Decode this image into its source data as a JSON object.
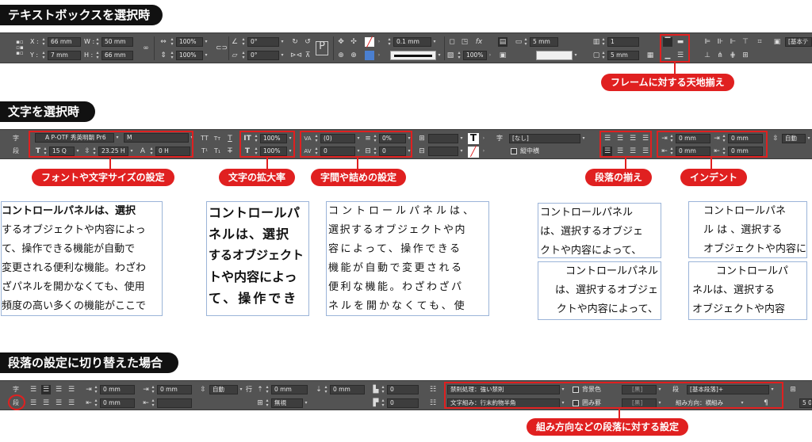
{
  "sections": {
    "textbox": "テキストボックスを選択時",
    "character": "文字を選択時",
    "paragraph": "段落の設定に切り替えた場合"
  },
  "toolbar1": {
    "x_label": "X :",
    "x_value": "66 mm",
    "y_label": "Y :",
    "y_value": "7 mm",
    "w_label": "W :",
    "w_value": "50 mm",
    "h_label": "H :",
    "h_value": "66 mm",
    "scale_x": "100%",
    "scale_y": "100%",
    "angle": "0°",
    "shear": "0°",
    "stroke_weight": "0.1 mm",
    "opacity": "100%",
    "col_gutter": "5 mm",
    "inset": "5 mm",
    "columns": "1",
    "style": "[基本テ"
  },
  "toolbar2": {
    "char_label": "字",
    "para_label": "段",
    "font_family": "A P-OTF 秀英明朝 Pr6",
    "font_style": "M",
    "font_size": "15 Q",
    "leading": "23.25 H",
    "tracking_h": "0 H",
    "scale_v": "100%",
    "scale_h": "100%",
    "kerning": "(0)",
    "tsume": "0%",
    "tracking": "0",
    "aki": "0",
    "char_style_label": "字",
    "char_style": "[なし]",
    "tate_chu_yoko": "縦中横",
    "indent_left": "0 mm",
    "indent_first": "0 mm",
    "indent_right": "0 mm",
    "indent_last": "0 mm",
    "auto": "自動"
  },
  "toolbar3": {
    "para_label": "段",
    "left_indent": "0 mm",
    "right_indent": "0 mm",
    "space_before": "0 mm",
    "space_after": "0 mm",
    "first_indent": "0 mm",
    "leading_auto": "自動",
    "line_label": "行",
    "grid": "無視",
    "drop_lines": "0",
    "drop_chars": "0",
    "kinsoku": "禁則処理：強い禁則",
    "mojikumi": "文字組み：行末約物半角",
    "bg_color": "背景色",
    "border": "囲み罫",
    "swatch1": "[黒]",
    "swatch2": "[黒]",
    "para_style_label": "段",
    "para_style": "[基本段落]+",
    "direction": "組み方向：横組み",
    "trailing": "5 0"
  },
  "callouts": {
    "frame_align": "フレームに対する天地揃え",
    "font_size": "フォントや文字サイズの設定",
    "scale": "文字の拡大率",
    "spacing": "字間や詰めの設定",
    "align": "段落の揃え",
    "indent": "インデント",
    "paragraph": "組み方向などの段落に対する設定"
  },
  "samples": {
    "s1": [
      "コントロールパネルは、選択",
      "するオブジェクトや内容によっ",
      "て、操作できる機能が自動で",
      "変更される便利な機能。わざわ",
      "ざパネルを開かなくても、使用",
      "頻度の高い多くの機能がここで"
    ],
    "s2": [
      "コントロールパ",
      "ネルは、選択",
      "するオブジェクト",
      "トや内容によっ",
      "て、操作でき"
    ],
    "s3": [
      "コントロールパネルは、",
      "選択するオブジェクトや内",
      "容によって、操作できる",
      "機能が自動で変更される",
      "便利な機能。わざわざパ",
      "ネルを開かなくても、使"
    ],
    "s4": [
      "コントロールパネル",
      "は、選択するオブジェ",
      "クトや内容によって、"
    ],
    "s5": [
      "コントロールパネ",
      "ル は 、選択する",
      "オブジェクトや内容に"
    ],
    "s6": [
      "コントロールパネル",
      "は、選択するオブジェ",
      "クトや内容によって、"
    ],
    "s7": [
      "コントロールパ",
      "ネルは、選択する",
      "オブジェクトや内容"
    ]
  }
}
